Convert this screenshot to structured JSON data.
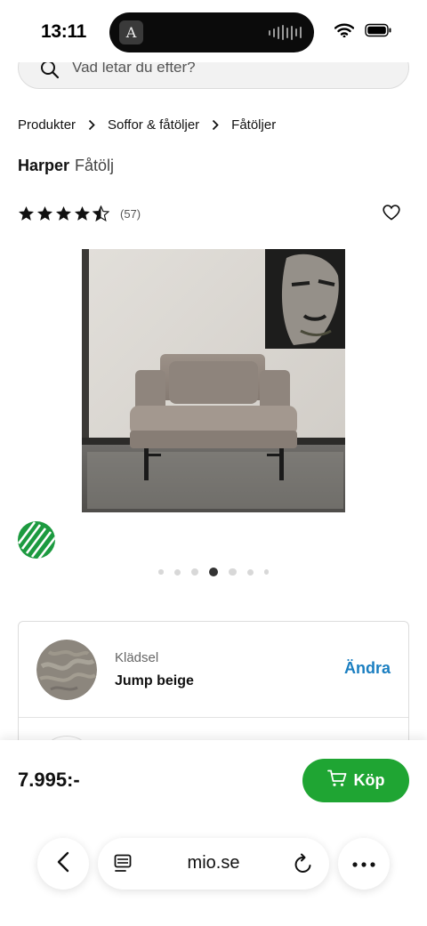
{
  "status_bar": {
    "time": "13:11",
    "app_glyph": "A"
  },
  "search": {
    "placeholder": "Vad letar du efter?"
  },
  "breadcrumb": [
    "Produkter",
    "Soffor & fåtöljer",
    "Fåtöljer"
  ],
  "product": {
    "name": "Harper",
    "type": "Fåtölj",
    "rating": 4.5,
    "review_count": "(57)"
  },
  "gallery": {
    "dot_count": 7,
    "active_index": 3
  },
  "options": [
    {
      "label": "Klädsel",
      "value": "Jump beige",
      "action": "Ändra"
    }
  ],
  "purchase": {
    "price": "7.995:-",
    "buy_label": "Köp"
  },
  "browser": {
    "url": "mio.se"
  },
  "colors": {
    "buy_green": "#1fa533",
    "link_blue": "#1b7fc1",
    "eco_green": "#1c9a3f"
  },
  "icons": [
    "search-icon",
    "chevron-right-icon",
    "star-icon",
    "heart-icon",
    "swan-ecolabel-icon",
    "cart-icon",
    "back-icon",
    "reader-icon",
    "reload-icon",
    "more-icon",
    "wifi-icon",
    "battery-icon"
  ]
}
